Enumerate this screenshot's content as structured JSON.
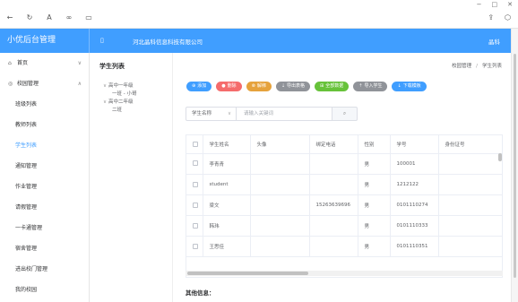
{
  "browser": {
    "window_controls": [
      "−",
      "□",
      "✕"
    ],
    "nav_icons": [
      "back-icon",
      "reload-icon",
      "font-icon",
      "link-icon",
      "save-icon"
    ],
    "right_icons": [
      "share-icon",
      "settings-icon"
    ]
  },
  "header": {
    "app_title": "小优后台管理",
    "menu_toggle": "▯",
    "company": "河北晶科信息科技有限公司",
    "user": "晶科"
  },
  "sidebar": {
    "items": [
      {
        "label": "首页",
        "top": true,
        "icon": "⌂",
        "chevron": "∨"
      },
      {
        "label": "校园管理",
        "top": true,
        "icon": "◎",
        "chevron": "∧"
      },
      {
        "label": "班级列表"
      },
      {
        "label": "教师列表"
      },
      {
        "label": "学生列表",
        "active": true
      },
      {
        "label": "通知管理"
      },
      {
        "label": "作业管理"
      },
      {
        "label": "请假管理"
      },
      {
        "label": "一卡通管理"
      },
      {
        "label": "宿舍管理"
      },
      {
        "label": "进出校门管理"
      },
      {
        "label": "我的校园"
      }
    ]
  },
  "tree_panel": {
    "title": "学生列表",
    "nodes": [
      {
        "caret": "∨",
        "label": "高中一年级",
        "level": 1
      },
      {
        "label": "一班 - 小哥",
        "level": 2
      },
      {
        "caret": "∨",
        "label": "高中二年级",
        "level": 1
      },
      {
        "label": "二班",
        "level": 2
      }
    ]
  },
  "breadcrumb": {
    "items": [
      "校园管理",
      "学生列表"
    ],
    "separator": "/"
  },
  "toolbar": {
    "buttons": [
      {
        "label": "添加",
        "icon": "⊕",
        "color": "#409eff",
        "name": "add-button"
      },
      {
        "label": "删除",
        "icon": "●",
        "color": "#f56c6c",
        "name": "delete-button"
      },
      {
        "label": "解绑",
        "icon": "⊗",
        "color": "#e6a23c",
        "name": "unbind-button"
      },
      {
        "label": "导出表格",
        "icon": "⇣",
        "color": "#909399",
        "name": "export-button"
      },
      {
        "label": "全部数据",
        "icon": "⊞",
        "color": "#67c23a",
        "name": "all-data-button"
      },
      {
        "label": "导入学生",
        "icon": "⇡",
        "color": "#909399",
        "name": "import-button"
      },
      {
        "label": "下载模板",
        "icon": "↓",
        "color": "#409eff",
        "name": "download-template-button"
      }
    ]
  },
  "search": {
    "field_select": "学生名称",
    "placeholder": "请输入关键词",
    "button_icon": "⌕"
  },
  "table": {
    "columns": [
      "",
      "学生姓名",
      "头像",
      "绑定电话",
      "性别",
      "学号",
      "身份证号"
    ],
    "rows": [
      [
        "",
        "李青青",
        "",
        "",
        "男",
        "100001",
        ""
      ],
      [
        "",
        "student",
        "",
        "",
        "男",
        "1212122",
        ""
      ],
      [
        "",
        "梁文",
        "",
        "15263639696",
        "男",
        "0101110274",
        ""
      ],
      [
        "",
        "韩玮",
        "",
        "",
        "男",
        "0101110333",
        ""
      ],
      [
        "",
        "王思佳",
        "",
        "",
        "男",
        "0101110351",
        ""
      ]
    ]
  },
  "other_info": "其他信息："
}
